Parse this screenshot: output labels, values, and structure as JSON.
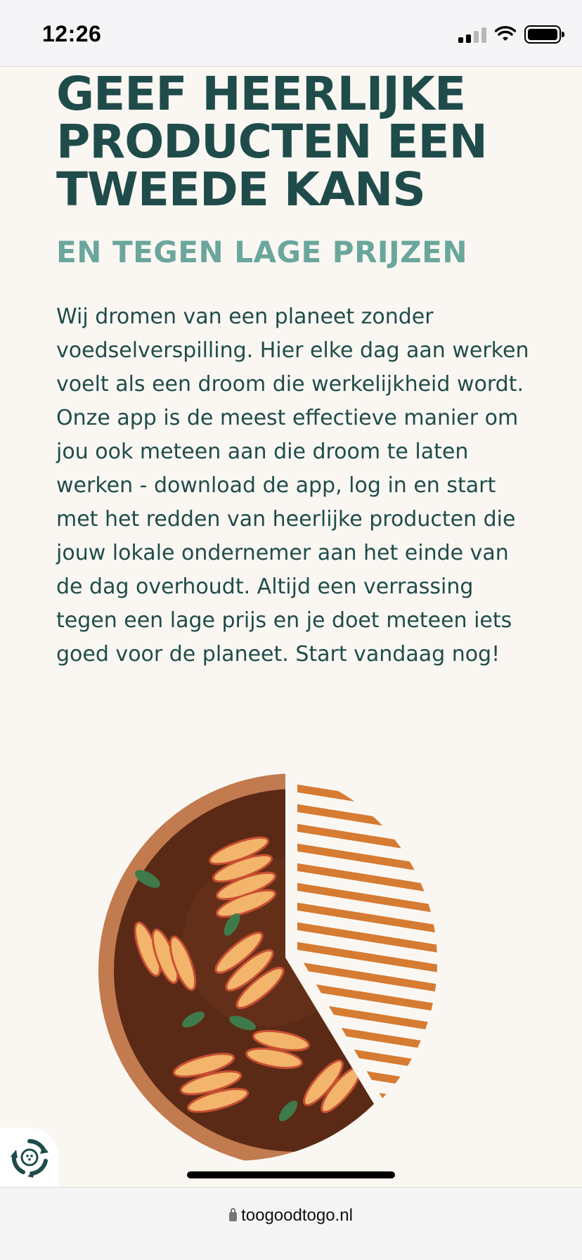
{
  "status": {
    "time": "12:26"
  },
  "hero": {
    "title": "GEEF HEERLIJKE PRODUCTEN EEN TWEEDE KANS",
    "subtitle": "EN TEGEN LAGE PRIJZEN",
    "body": "Wij dromen van een planeet zonder voedselverspilling. Hier elke dag aan werken voelt als een droom die werkelijkheid wordt. Onze app is de meest effectieve manier om jou ook meteen aan die droom te laten werken - download de app, log in en start met het redden van heerlijke producten die jouw lokale ondernemer aan het einde van de dag overhoudt. Altijd een verrassing tegen een lage prijs en je doet meteen iets goed voor de planeet. Start vandaag nog!"
  },
  "illustration": {
    "icon": "pie-tart-illustration",
    "colors": {
      "crust": "#c27a4f",
      "filling": "#5a2a17",
      "stripes": "#d67b32"
    }
  },
  "browser": {
    "url": "toogoodtogo.nl"
  },
  "colors": {
    "headline": "#1f4c4a",
    "subheadline": "#6aa69c",
    "background": "#faf7f2"
  }
}
